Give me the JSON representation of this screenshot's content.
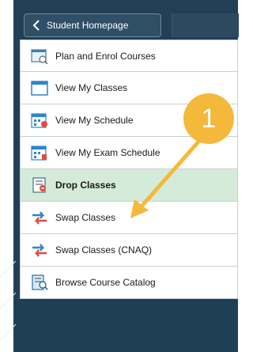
{
  "header": {
    "back_label": "Student Homepage",
    "back_icon": "chevron-left-icon"
  },
  "menu": {
    "items": [
      {
        "label": "Plan and Enrol Courses",
        "icon": "plan-icon"
      },
      {
        "label": "View My Classes",
        "icon": "calendar-icon"
      },
      {
        "label": "View My Schedule",
        "icon": "schedule-icon"
      },
      {
        "label": "View My Exam Schedule",
        "icon": "exam-schedule-icon"
      },
      {
        "label": "Drop Classes",
        "icon": "drop-icon",
        "selected": true
      },
      {
        "label": "Swap Classes",
        "icon": "swap-icon"
      },
      {
        "label": "Swap Classes (CNAQ)",
        "icon": "swap-icon"
      },
      {
        "label": "Browse Course Catalog",
        "icon": "catalog-icon"
      }
    ]
  },
  "annotation": {
    "number": "1",
    "color": "#f4b93a"
  },
  "colors": {
    "frame": "#1f3f57",
    "active_row": "#d5ebda"
  }
}
